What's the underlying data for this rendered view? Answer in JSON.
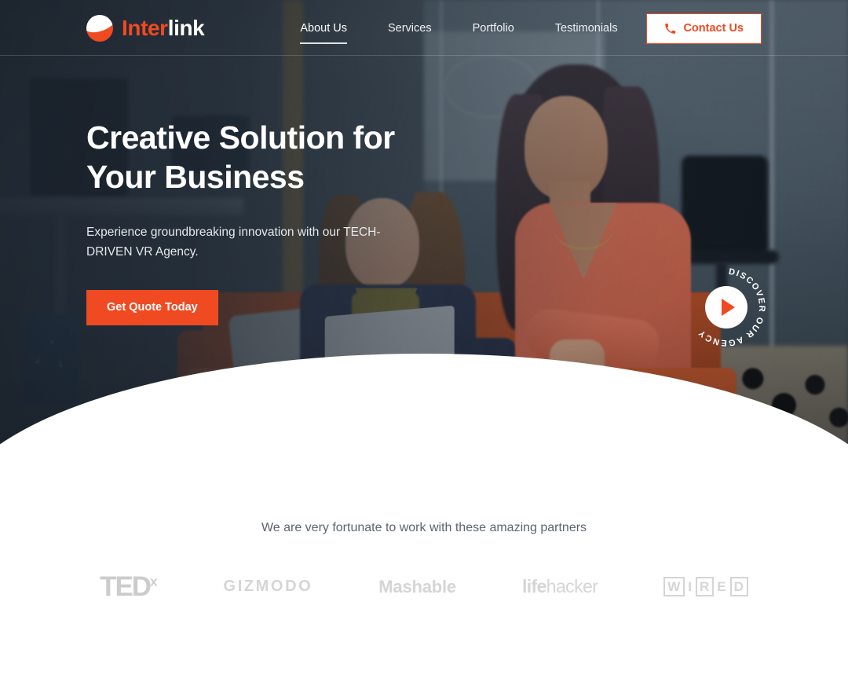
{
  "brand": {
    "name_part1": "Inter",
    "name_part2": "link",
    "logo_icon": "interlink-wave-logo"
  },
  "nav": {
    "items": [
      {
        "label": "About Us",
        "active": true
      },
      {
        "label": "Services",
        "active": false
      },
      {
        "label": "Portfolio",
        "active": false
      },
      {
        "label": "Testimonials",
        "active": false
      }
    ]
  },
  "header": {
    "contact_button": {
      "label": "Contact Us",
      "icon": "phone-icon"
    }
  },
  "hero": {
    "title_line1": "Creative Solution for",
    "title_line2": "Your Business",
    "subtitle": "Experience groundbreaking innovation with our TECH-DRIVEN VR Agency.",
    "cta_label": "Get Quote Today",
    "badge_text": "DISCOVER OUR AGENCY",
    "badge_icon": "play-icon"
  },
  "partners": {
    "heading": "We are very fortunate to work with these amazing partners",
    "logos": [
      {
        "name": "TEDx",
        "main": "TED",
        "sup": "x"
      },
      {
        "name": "GIZMODO",
        "text": "GIZMODO"
      },
      {
        "name": "Mashable",
        "text": "Mashable"
      },
      {
        "name": "lifehacker",
        "bold": "life",
        "rest": "hacker"
      },
      {
        "name": "WIRED",
        "letters": [
          "W",
          "I",
          "R",
          "E",
          "D"
        ]
      }
    ]
  },
  "colors": {
    "accent": "#F04A23",
    "hero_overlay": "#1C242E",
    "partner_text": "#5B6470",
    "partner_logo": "#D2D5D9"
  }
}
